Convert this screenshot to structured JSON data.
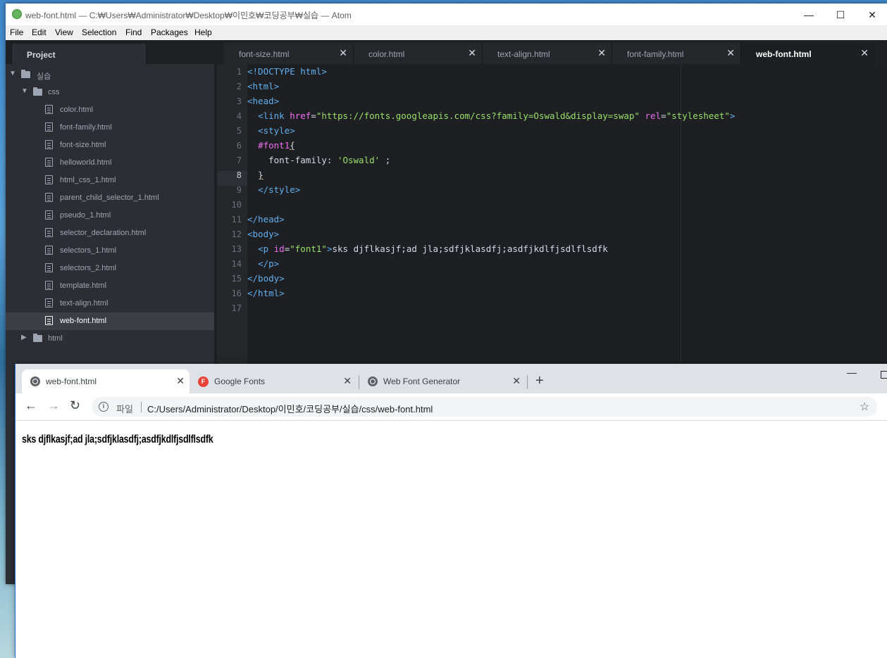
{
  "atom": {
    "title": "web-font.html — C:₩Users₩Administrator₩Desktop₩이민호₩코딩공부₩실습 — Atom",
    "window_buttons": {
      "minimize": "—",
      "maximize": "☐",
      "close": "✕"
    },
    "menu": [
      "File",
      "Edit",
      "View",
      "Selection",
      "Find",
      "Packages",
      "Help"
    ],
    "tree": {
      "panel_title": "Project",
      "root": "실습",
      "folder_css": "css",
      "files": [
        "color.html",
        "font-family.html",
        "font-size.html",
        "helloworld.html",
        "html_css_1.html",
        "parent_child_selector_1.html",
        "pseudo_1.html",
        "selector_declaration.html",
        "selectors_1.html",
        "selectors_2.html",
        "template.html",
        "text-align.html",
        "web-font.html"
      ],
      "selected": "web-font.html",
      "folder_html": "html"
    },
    "tabs": [
      "font-size.html",
      "color.html",
      "text-align.html",
      "font-family.html",
      "web-font.html"
    ],
    "active_tab": "web-font.html",
    "line_numbers": [
      "1",
      "2",
      "3",
      "4",
      "5",
      "6",
      "7",
      "8",
      "9",
      "10",
      "11",
      "12",
      "13",
      "14",
      "15",
      "16",
      "17"
    ],
    "current_line": "8",
    "code": {
      "l1": "<!DOCTYPE html>",
      "l2": "<html>",
      "l3": "<head>",
      "l4_tag_open": "<link",
      "l4_attr1": "href",
      "l4_val1": "\"https://fonts.googleapis.com/css?family=Oswald&display=swap\"",
      "l4_attr2": "rel",
      "l4_val2": "\"stylesheet\"",
      "l4_close": ">",
      "l5": "<style>",
      "l6_selector": "#font1",
      "l6_brace": "{",
      "l7_prop": "font-family: ",
      "l7_val": "'Oswald'",
      "l7_end": " ;",
      "l8": "}",
      "l9": "</style>",
      "l11": "</head>",
      "l12": "<body>",
      "l13_tag": "<p",
      "l13_attr": "id",
      "l13_val": "\"font1\"",
      "l13_close": ">",
      "l13_text": "sks djflkasjf;ad jla;sdfjklasdfj;asdfjkdlfjsdlflsdfk",
      "l14": "</p>",
      "l15": "</body>",
      "l16": "</html>"
    }
  },
  "chrome": {
    "tabs": [
      {
        "label": "web-font.html",
        "icon": "globe-icon"
      },
      {
        "label": "Google Fonts",
        "icon": "google-fonts-icon",
        "icon_letter": "F"
      },
      {
        "label": "Web Font Generator",
        "icon": "globe-icon"
      }
    ],
    "new_tab": "+",
    "omnibox": {
      "prefix": "파일",
      "url": "C:/Users/Administrator/Desktop/이민호/코딩공부/실습/css/web-font.html"
    },
    "page_text": "sks djflkasjf;ad jla;sdfjklasdfj;asdfjkdlfjsdlflsdfk"
  },
  "colors": {
    "atom_bg": "#1d1f23",
    "tag": "#61afef",
    "attr": "#f16ff3",
    "string": "#98e06a",
    "chrome_tabstrip": "#dee1e6"
  }
}
